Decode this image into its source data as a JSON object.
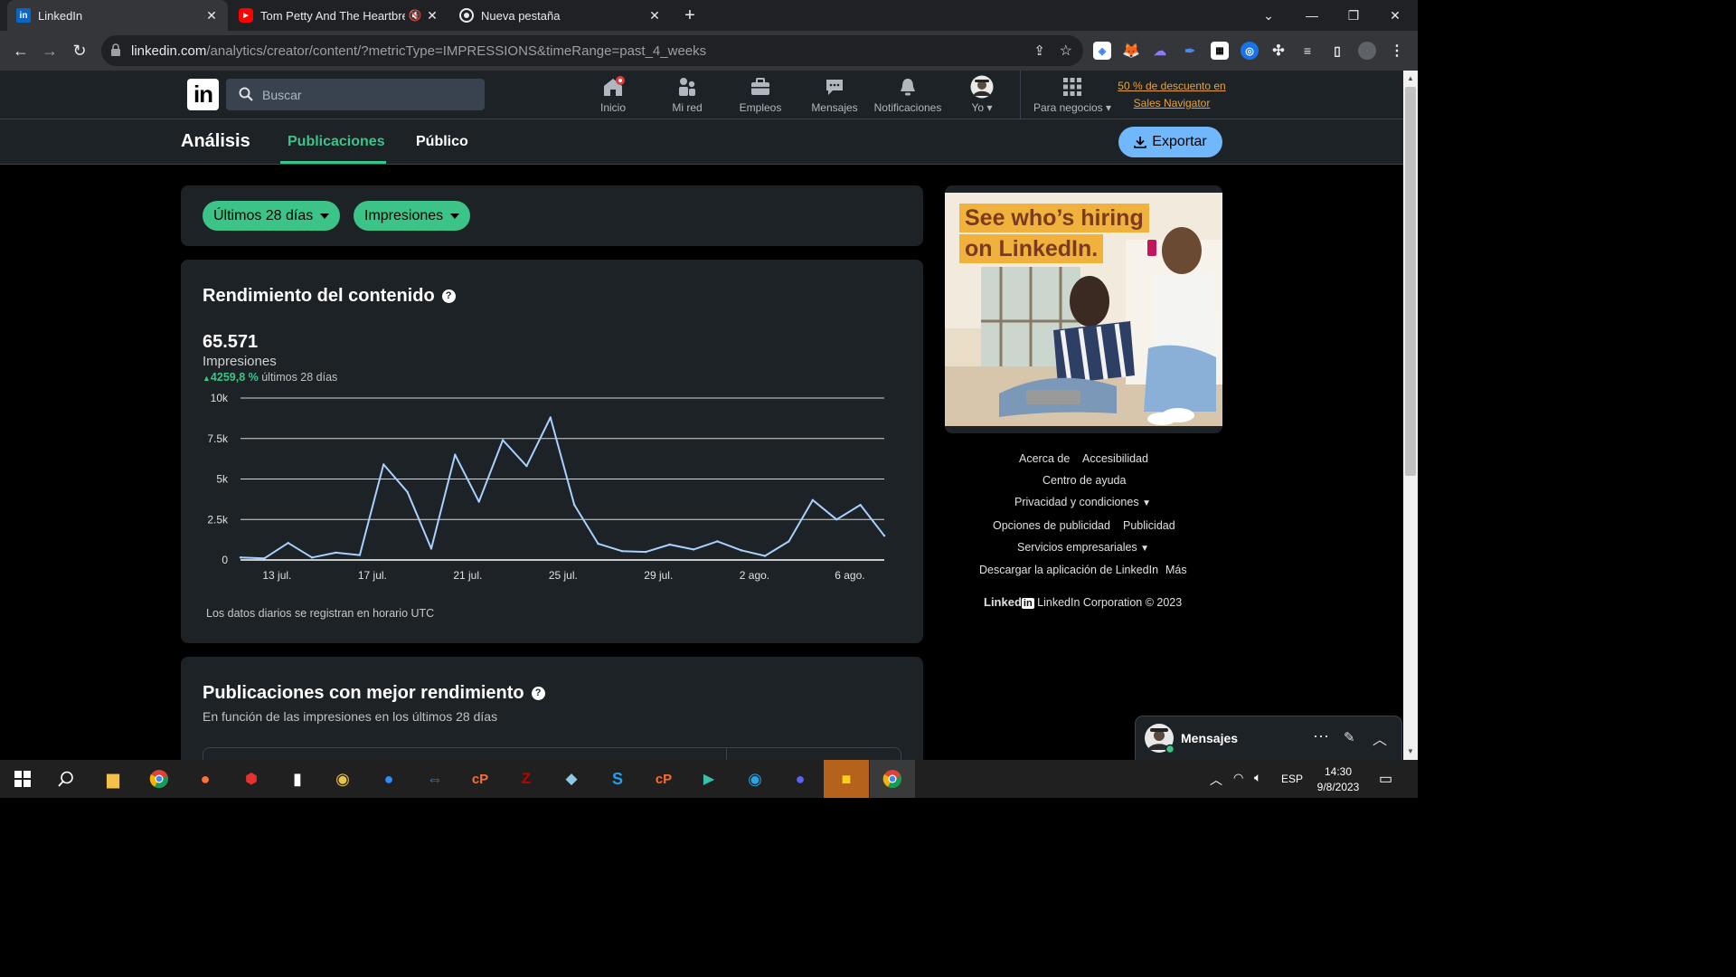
{
  "browser": {
    "tabs": [
      {
        "title": "LinkedIn",
        "icon": "linkedin-favicon",
        "active": true
      },
      {
        "title": "Tom Petty And The Heartbreakers",
        "icon": "youtube-favicon",
        "muted": true
      },
      {
        "title": "Nueva pestaña",
        "icon": "chrome-favicon"
      }
    ],
    "url_host": "linkedin.com",
    "url_path": "/analytics/creator/content/?metricType=IMPRESSIONS&timeRange=past_4_weeks"
  },
  "header": {
    "search_placeholder": "Buscar",
    "nav": [
      {
        "label": "Inicio",
        "icon": "home-icon"
      },
      {
        "label": "Mi red",
        "icon": "network-icon"
      },
      {
        "label": "Empleos",
        "icon": "briefcase-icon"
      },
      {
        "label": "Mensajes",
        "icon": "chat-icon"
      },
      {
        "label": "Notificaciones",
        "icon": "bell-icon"
      },
      {
        "label": "Yo",
        "icon": "avatar"
      },
      {
        "label": "Para negocios",
        "icon": "grid-icon"
      }
    ],
    "promo_line1": "50 % de descuento en",
    "promo_line2": "Sales Navigator"
  },
  "subheader": {
    "title": "Análisis",
    "tabs": [
      "Publicaciones",
      "Público"
    ],
    "active_tab": "Publicaciones",
    "export_label": "Exportar"
  },
  "filters": {
    "time": "Últimos 28 días",
    "metric": "Impresiones"
  },
  "performance": {
    "title": "Rendimiento del contenido",
    "total": "65.571",
    "total_label": "Impresiones",
    "change": "4259,8 %",
    "change_period": "últimos 28 días",
    "footnote": "Los datos diarios se registran en horario UTC"
  },
  "chart_data": {
    "type": "line",
    "x": [
      "2023-07-12",
      "2023-07-13",
      "2023-07-14",
      "2023-07-15",
      "2023-07-16",
      "2023-07-17",
      "2023-07-18",
      "2023-07-19",
      "2023-07-20",
      "2023-07-21",
      "2023-07-22",
      "2023-07-23",
      "2023-07-24",
      "2023-07-25",
      "2023-07-26",
      "2023-07-27",
      "2023-07-28",
      "2023-07-29",
      "2023-07-30",
      "2023-07-31",
      "2023-08-01",
      "2023-08-02",
      "2023-08-03",
      "2023-08-04",
      "2023-08-05",
      "2023-08-06",
      "2023-08-07",
      "2023-08-08"
    ],
    "values": [
      150,
      100,
      1050,
      150,
      450,
      300,
      5900,
      4200,
      700,
      6500,
      3600,
      7400,
      5800,
      8800,
      3400,
      1000,
      550,
      500,
      950,
      650,
      1150,
      600,
      250,
      1150,
      3700,
      2500,
      3400,
      1500
    ],
    "xticks": [
      "13 jul.",
      "17 jul.",
      "21 jul.",
      "25 jul.",
      "29 jul.",
      "2 ago.",
      "6 ago."
    ],
    "xtick_values": [
      "2023-07-13",
      "2023-07-17",
      "2023-07-21",
      "2023-07-25",
      "2023-07-29",
      "2023-08-02",
      "2023-08-06"
    ],
    "yticks": [
      "0",
      "2.5k",
      "5k",
      "7.5k",
      "10k"
    ],
    "ytick_values": [
      0,
      2500,
      5000,
      7500,
      10000
    ],
    "ylim": [
      0,
      10000
    ],
    "grid": true,
    "line_color": "#a8d1ff"
  },
  "top_posts": {
    "title": "Publicaciones con mejor rendimiento",
    "subtitle": "En función de las impresiones en los últimos 28 días"
  },
  "ad": {
    "line1": "See who’s hiring",
    "line2": "on LinkedIn."
  },
  "footer": {
    "links_row1": [
      "Acerca de",
      "Accesibilidad"
    ],
    "link_help": "Centro de ayuda",
    "link_privacy": "Privacidad y condiciones",
    "links_row4": [
      "Opciones de publicidad",
      "Publicidad"
    ],
    "link_services": "Servicios empresariales",
    "link_app": "Descargar la aplicación de LinkedIn",
    "link_more": "Más",
    "brand": "Linked",
    "brand_in": "in",
    "copyright": "LinkedIn Corporation © 2023"
  },
  "messaging": {
    "label": "Mensajes"
  },
  "taskbar": {
    "lang": "ESP",
    "time": "14:30",
    "date": "9/8/2023"
  },
  "colors": {
    "accent_green": "#3cc488",
    "link_blue": "#71b7fb",
    "card_bg": "#1d2226",
    "promo": "#e7a33e"
  }
}
